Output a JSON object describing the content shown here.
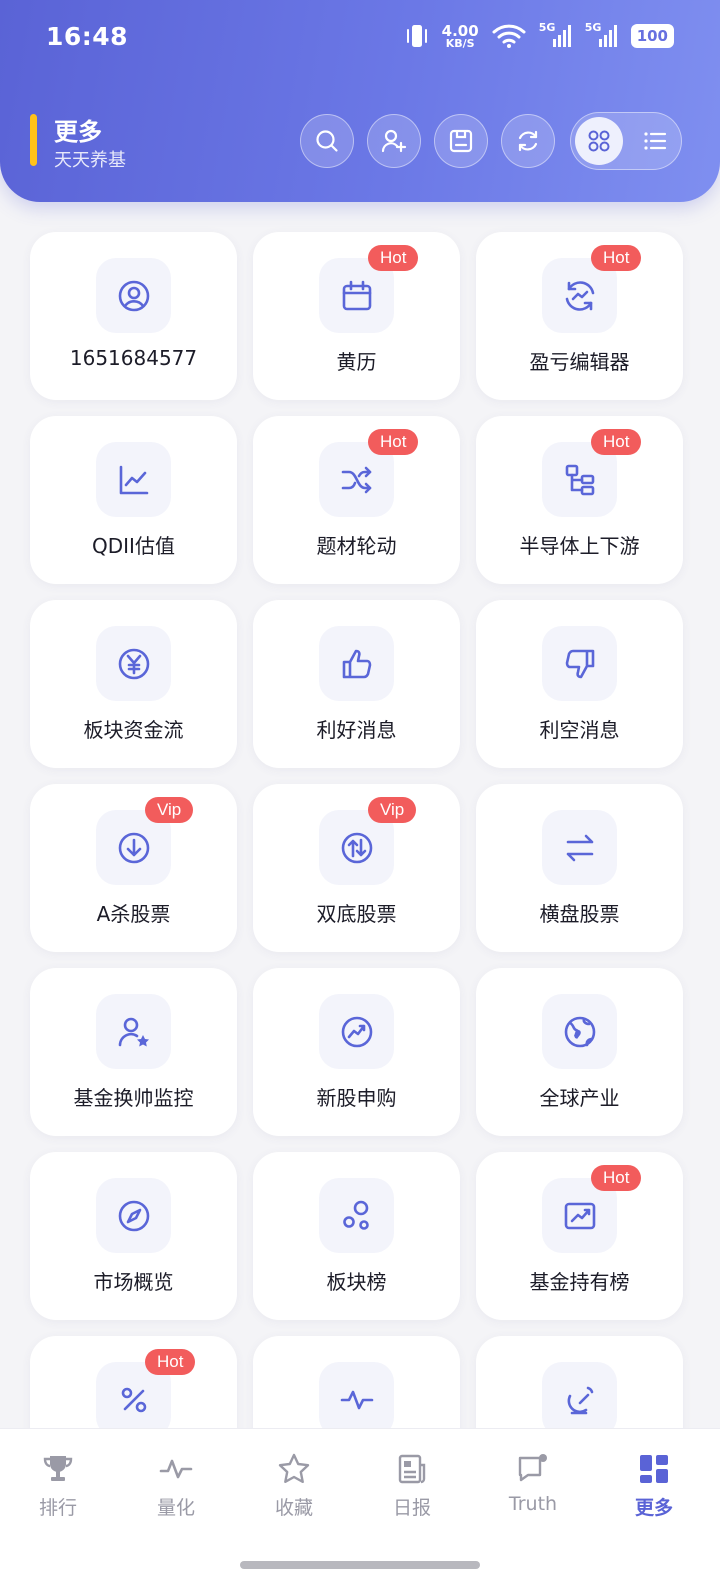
{
  "status_bar": {
    "time": "16:48",
    "net_speed": "4.00",
    "net_unit": "KB/S",
    "sig1": "5G",
    "sig2": "5G",
    "battery": "100"
  },
  "header": {
    "title": "更多",
    "subtitle": "天天养基",
    "accent_color": "#ffc21a",
    "tools": [
      "search-icon",
      "add-user-icon",
      "save-icon",
      "refresh-icon"
    ],
    "view_modes": [
      "grid-view-icon",
      "list-view-icon"
    ],
    "active_view": "grid"
  },
  "grid": {
    "items": [
      {
        "label": "1651684577",
        "icon": "user-circle-icon",
        "badge": ""
      },
      {
        "label": "黄历",
        "icon": "calendar-icon",
        "badge": "Hot"
      },
      {
        "label": "盈亏编辑器",
        "icon": "cycle-chart-icon",
        "badge": "Hot"
      },
      {
        "label": "QDII估值",
        "icon": "line-chart-icon",
        "badge": ""
      },
      {
        "label": "题材轮动",
        "icon": "shuffle-icon",
        "badge": "Hot"
      },
      {
        "label": "半导体上下游",
        "icon": "hierarchy-icon",
        "badge": "Hot"
      },
      {
        "label": "板块资金流",
        "icon": "yen-icon",
        "badge": ""
      },
      {
        "label": "利好消息",
        "icon": "thumbs-up-icon",
        "badge": ""
      },
      {
        "label": "利空消息",
        "icon": "thumbs-down-icon",
        "badge": ""
      },
      {
        "label": "A杀股票",
        "icon": "arrow-down-circle-icon",
        "badge": "Vip"
      },
      {
        "label": "双底股票",
        "icon": "arrows-updown-circle-icon",
        "badge": "Vip"
      },
      {
        "label": "横盘股票",
        "icon": "swap-arrows-icon",
        "badge": ""
      },
      {
        "label": "基金换帅监控",
        "icon": "user-star-icon",
        "badge": ""
      },
      {
        "label": "新股申购",
        "icon": "trend-circle-icon",
        "badge": ""
      },
      {
        "label": "全球产业",
        "icon": "globe-icon",
        "badge": ""
      },
      {
        "label": "市场概览",
        "icon": "compass-icon",
        "badge": ""
      },
      {
        "label": "板块榜",
        "icon": "bubbles-icon",
        "badge": ""
      },
      {
        "label": "基金持有榜",
        "icon": "chart-box-icon",
        "badge": "Hot"
      },
      {
        "label": "",
        "icon": "percent-icon",
        "badge": "Hot"
      },
      {
        "label": "",
        "icon": "pulse-icon",
        "badge": ""
      },
      {
        "label": "",
        "icon": "dish-icon",
        "badge": ""
      }
    ],
    "badge_color": "#f25c5c",
    "icon_color": "#5a66d8"
  },
  "bottom_nav": {
    "items": [
      {
        "label": "排行",
        "icon": "trophy-icon"
      },
      {
        "label": "量化",
        "icon": "pulse-line-icon"
      },
      {
        "label": "收藏",
        "icon": "star-icon"
      },
      {
        "label": "日报",
        "icon": "newspaper-icon"
      },
      {
        "label": "Truth",
        "icon": "chat-dot-icon"
      },
      {
        "label": "更多",
        "icon": "dashboard-icon"
      }
    ],
    "active_index": 5,
    "active_color": "#5a63d6"
  }
}
